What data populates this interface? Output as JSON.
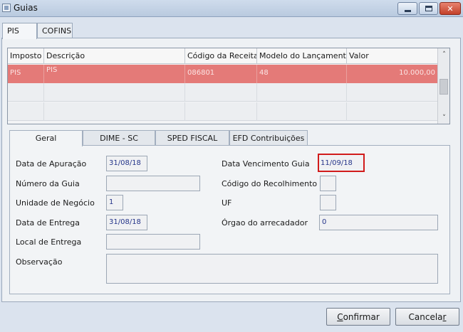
{
  "window": {
    "title": "Guias",
    "min_label": "_",
    "max_label": "□",
    "close_label": "✕"
  },
  "top_tabs": [
    {
      "label": "PIS",
      "active": true
    },
    {
      "label": "COFINS",
      "active": false
    }
  ],
  "grid": {
    "columns": [
      "Imposto",
      "Descrição",
      "Código da Receita",
      "Modelo do Lançamento",
      "Valor"
    ],
    "rows": [
      {
        "imposto": "PIS",
        "descricao": "PIS",
        "codigo": "086801",
        "modelo": "48",
        "valor": "10.000,00",
        "selected": true
      }
    ],
    "scroll_up": "˄",
    "scroll_down": "˅"
  },
  "inner_tabs": [
    {
      "label": "Geral",
      "active": true
    },
    {
      "label": "DIME - SC",
      "active": false
    },
    {
      "label": "SPED FISCAL",
      "active": false
    },
    {
      "label": "EFD Contribuições",
      "active": false
    }
  ],
  "form": {
    "data_apuracao": {
      "label": "Data de Apuração",
      "value": "31/08/18"
    },
    "numero_guia": {
      "label": "Número da Guia",
      "value": ""
    },
    "unidade_negocio": {
      "label": "Unidade de Negócio",
      "value": "1"
    },
    "data_entrega": {
      "label": "Data de Entrega",
      "value": "31/08/18"
    },
    "local_entrega": {
      "label": "Local de Entrega",
      "value": ""
    },
    "observacao": {
      "label": "Observação",
      "value": ""
    },
    "data_vencimento": {
      "label": "Data Vencimento Guia",
      "value": "11/09/18"
    },
    "codigo_recolhimento": {
      "label": "Código do Recolhimento",
      "value": ""
    },
    "uf": {
      "label": "UF",
      "value": ""
    },
    "orgao_arrecadador": {
      "label": "Órgao do arrecadador",
      "value": "0"
    }
  },
  "buttons": {
    "confirmar_first": "C",
    "confirmar_rest": "onfirmar",
    "cancelar_main": "Cancela",
    "cancelar_last": "r"
  },
  "colors": {
    "selected_row": "#e47a78",
    "highlight_border": "#d11b1b",
    "field_text": "#25358a"
  }
}
